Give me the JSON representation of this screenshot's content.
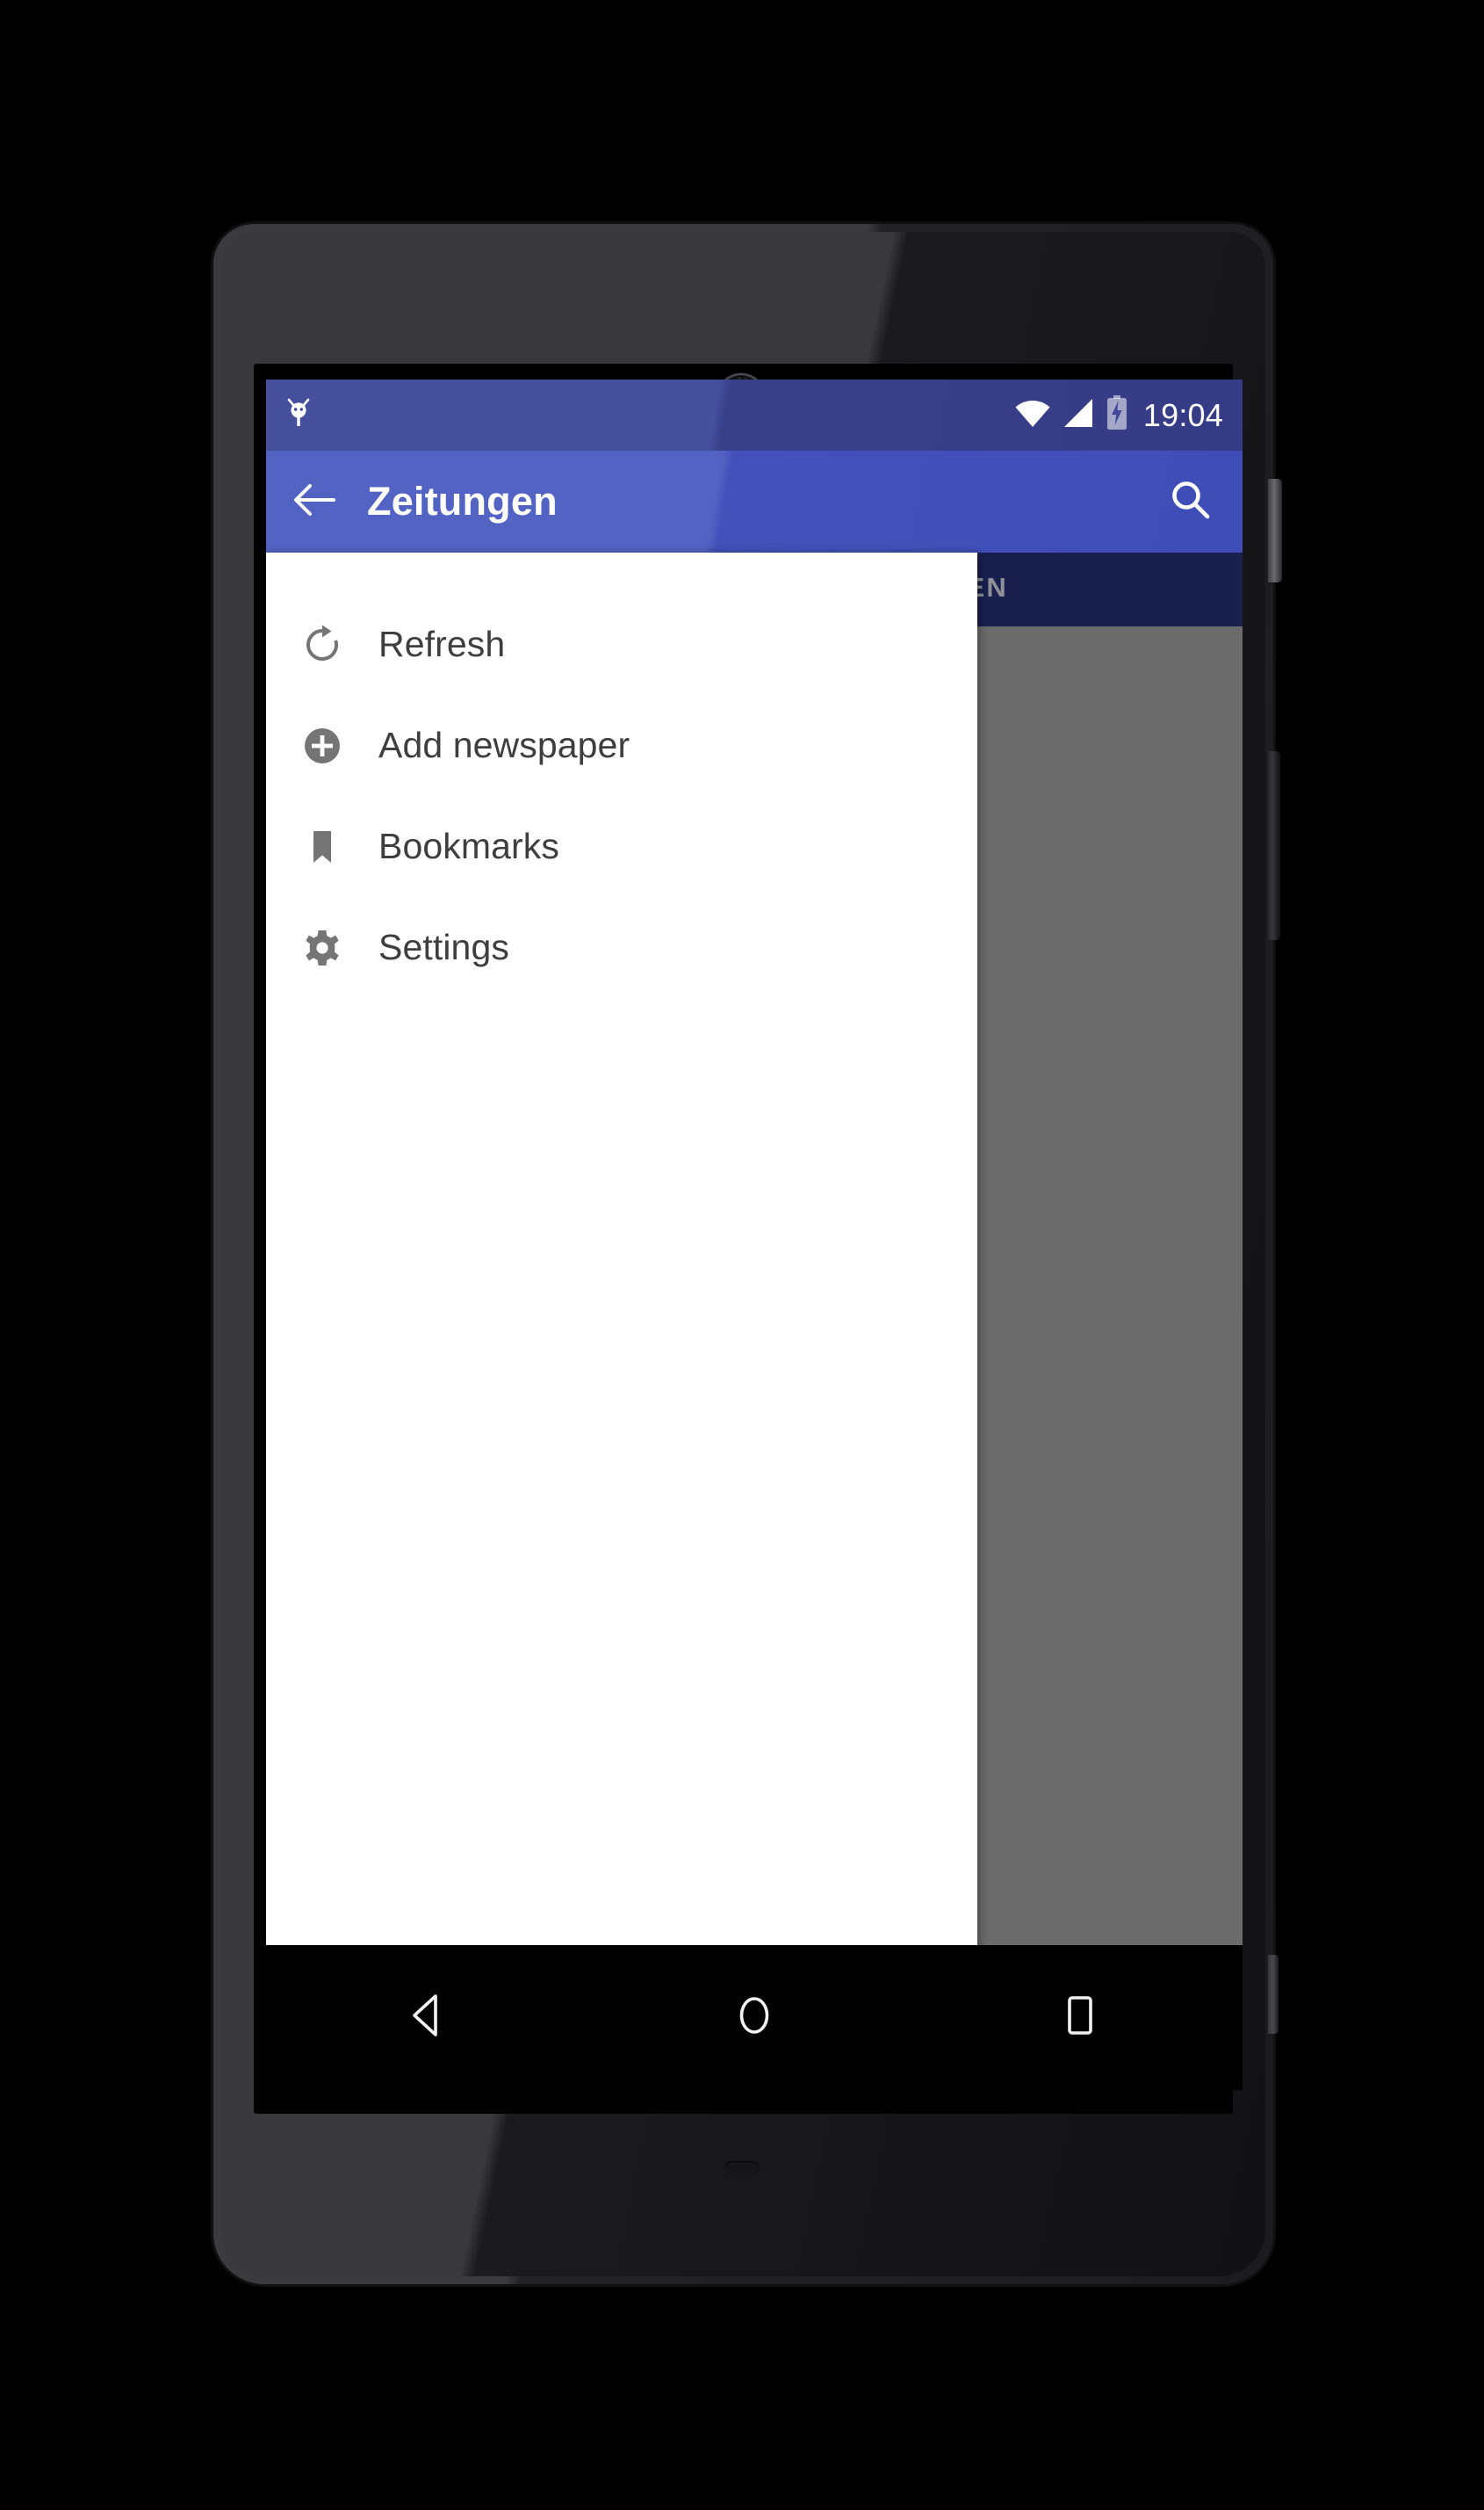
{
  "device": {
    "model_style": "nexus-5-black",
    "frame_color": "#2b2b2d"
  },
  "status_bar": {
    "debug_icon": "android-bug-icon",
    "wifi_icon": "wifi-icon",
    "signal_icon": "cellular-signal-icon",
    "battery_icon": "battery-charging-icon",
    "clock": "19:04",
    "background_color": "#3f4897"
  },
  "action_bar": {
    "back_icon": "arrow-left-icon",
    "title": "Zeitungen",
    "search_icon": "search-icon",
    "background_color": "#4b5bbf"
  },
  "tab_strip": {
    "visible_label": "RITEN",
    "full_label": "FAVORITEN",
    "background_color": "#19204e",
    "label_color": "#8e9196"
  },
  "scrim": {
    "color": "#6b6b6b"
  },
  "drawer": {
    "background_color": "#ffffff",
    "icon_color": "#757575",
    "label_color": "#3e3e3e",
    "items": [
      {
        "id": "refresh",
        "label": "Refresh",
        "icon": "refresh-icon"
      },
      {
        "id": "add-newspaper",
        "label": "Add newspaper",
        "icon": "add-circle-icon"
      },
      {
        "id": "bookmarks",
        "label": "Bookmarks",
        "icon": "bookmark-icon"
      },
      {
        "id": "settings",
        "label": "Settings",
        "icon": "gear-icon"
      }
    ]
  },
  "nav_bar": {
    "background_color": "#000000",
    "keys": [
      {
        "id": "back",
        "icon": "nav-back-triangle-icon"
      },
      {
        "id": "home",
        "icon": "nav-home-circle-icon"
      },
      {
        "id": "recents",
        "icon": "nav-recents-square-icon"
      }
    ]
  }
}
